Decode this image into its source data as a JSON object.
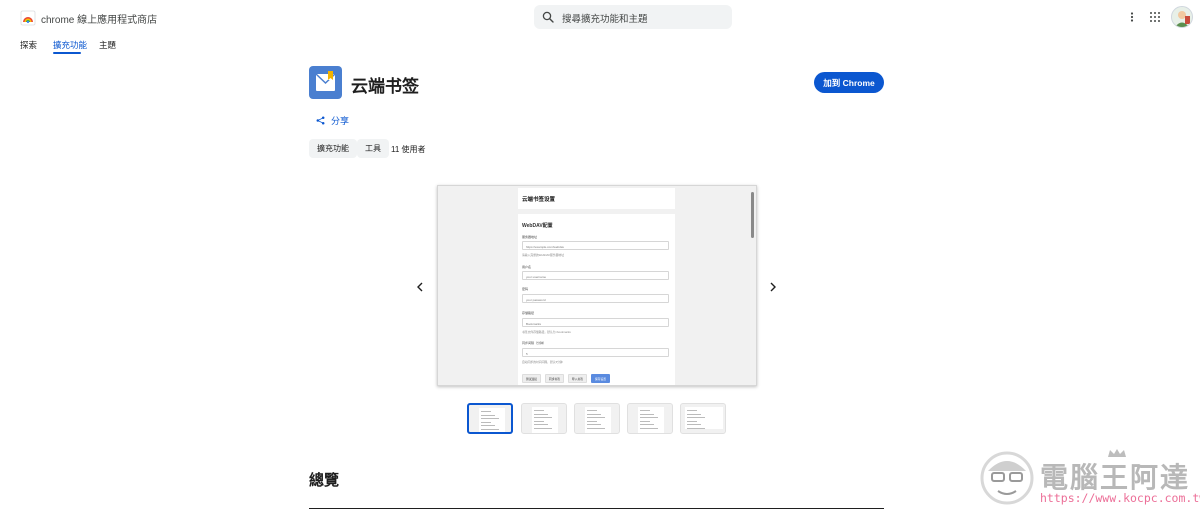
{
  "header": {
    "store_name": "chrome 線上應用程式商店",
    "search_placeholder": "搜尋擴充功能和主題",
    "icons": [
      "store-logo-icon",
      "search-icon",
      "more-vert-icon",
      "apps-grid-icon",
      "avatar"
    ]
  },
  "tabs": [
    {
      "label": "探索",
      "active": false
    },
    {
      "label": "擴充功能",
      "active": true
    },
    {
      "label": "主題",
      "active": false
    }
  ],
  "extension": {
    "title": "云端书签",
    "add_button": "加到 Chrome",
    "share_label": "分享",
    "chips": [
      "擴充功能",
      "工具"
    ],
    "users": "11 使用者"
  },
  "screenshot": {
    "page_title": "云端书签设置",
    "section": "WebDAV配置",
    "fields": [
      {
        "label": "服务器地址",
        "value": "https://example.com/webdav",
        "hint": "请输入完整的WebDAV服务器地址"
      },
      {
        "label": "用户名",
        "value": "your username",
        "hint": ""
      },
      {
        "label": "密码",
        "value": "your password",
        "hint": ""
      },
      {
        "label": "存储路径",
        "value": "Bookmarks",
        "hint": "书签文件存储路径，默认为 /bookmarks"
      },
      {
        "label": "同步间隔（分钟）",
        "value": "5",
        "hint": "自动同步的时间间隔，默认5分钟"
      }
    ],
    "buttons": [
      "测试连接",
      "同步书签",
      "导入书签",
      "保存设置"
    ]
  },
  "thumbnails_count": 5,
  "overview_title": "總覽",
  "watermark": {
    "text": "電腦王阿達",
    "url": "https://www.kocpc.com.tw/"
  },
  "colors": {
    "accent": "#0b57d0",
    "chip_bg": "#f1f3f4",
    "extension_icon": "#4a7fd0",
    "watermark_url": "#ec6f98"
  }
}
